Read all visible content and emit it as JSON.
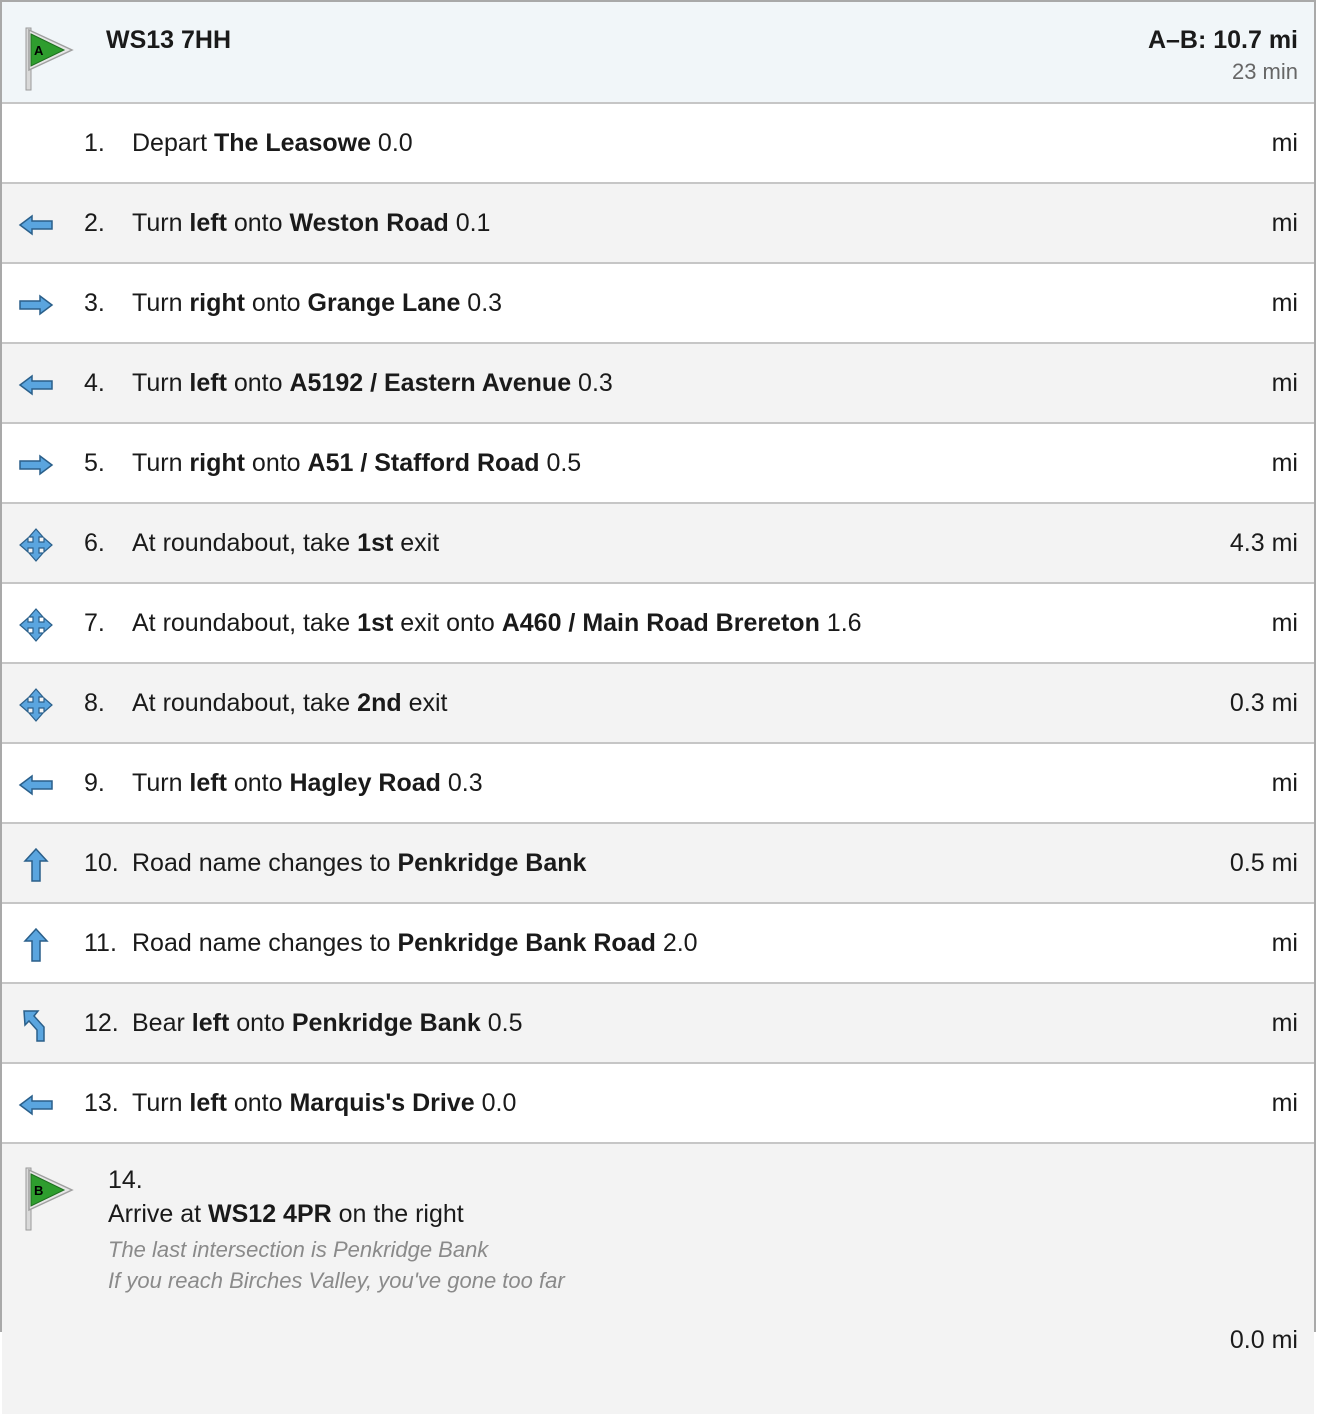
{
  "header": {
    "flag_label": "A",
    "title": "WS13 7HH",
    "total": "A–B: 10.7 mi",
    "time": "23 min"
  },
  "steps": [
    {
      "num": "1.",
      "icon": "none",
      "pre": "Depart ",
      "b1": "The Leasowe",
      "mid": "",
      "b2": "",
      "tail": " 0.0",
      "dist": "mi"
    },
    {
      "num": "2.",
      "icon": "turn-left-icon",
      "pre": "Turn ",
      "b1": "left",
      "mid": " onto ",
      "b2": "Weston Road",
      "tail": " 0.1",
      "dist": "mi"
    },
    {
      "num": "3.",
      "icon": "turn-right-icon",
      "pre": "Turn ",
      "b1": "right",
      "mid": " onto ",
      "b2": "Grange Lane",
      "tail": " 0.3",
      "dist": "mi"
    },
    {
      "num": "4.",
      "icon": "turn-left-icon",
      "pre": "Turn ",
      "b1": "left",
      "mid": " onto ",
      "b2": "A5192 / Eastern Avenue",
      "tail": " 0.3",
      "dist": "mi"
    },
    {
      "num": "5.",
      "icon": "turn-right-icon",
      "pre": "Turn ",
      "b1": "right",
      "mid": " onto ",
      "b2": "A51 / Stafford Road",
      "tail": " 0.5",
      "dist": "mi"
    },
    {
      "num": "6.",
      "icon": "roundabout-icon",
      "pre": "At roundabout, take ",
      "b1": "1st",
      "mid": " exit",
      "b2": "",
      "tail": "",
      "dist": "4.3 mi"
    },
    {
      "num": "7.",
      "icon": "roundabout-icon",
      "pre": "At roundabout, take ",
      "b1": "1st",
      "mid": " exit onto ",
      "b2": "A460 / Main Road Brereton",
      "tail": " 1.6",
      "dist": "mi"
    },
    {
      "num": "8.",
      "icon": "roundabout-icon",
      "pre": "At roundabout, take ",
      "b1": "2nd",
      "mid": " exit",
      "b2": "",
      "tail": "",
      "dist": "0.3 mi"
    },
    {
      "num": "9.",
      "icon": "turn-left-icon",
      "pre": "Turn ",
      "b1": "left",
      "mid": " onto ",
      "b2": "Hagley Road",
      "tail": " 0.3",
      "dist": "mi"
    },
    {
      "num": "10.",
      "icon": "straight-icon",
      "pre": "Road name changes to ",
      "b1": "Penkridge Bank",
      "mid": "",
      "b2": "",
      "tail": "",
      "dist": "0.5 mi"
    },
    {
      "num": "11.",
      "icon": "straight-icon",
      "pre": "Road name changes to ",
      "b1": "Penkridge Bank Road",
      "mid": "",
      "b2": "",
      "tail": " 2.0",
      "dist": "mi"
    },
    {
      "num": "12.",
      "icon": "bear-left-icon",
      "pre": "Bear ",
      "b1": "left",
      "mid": " onto ",
      "b2": "Penkridge Bank",
      "tail": " 0.5",
      "dist": "mi"
    },
    {
      "num": "13.",
      "icon": "turn-left-icon",
      "pre": "Turn ",
      "b1": "left",
      "mid": " onto ",
      "b2": "Marquis's Drive",
      "tail": " 0.0",
      "dist": "mi"
    }
  ],
  "arrive": {
    "flag_label": "B",
    "num": "14.",
    "pre": "Arrive at ",
    "b1": "WS12 4PR",
    "tail": " on the right",
    "note1": "The last intersection is Penkridge Bank",
    "note2": "If you reach Birches Valley, you've gone too far",
    "dist": "0.0 mi"
  }
}
